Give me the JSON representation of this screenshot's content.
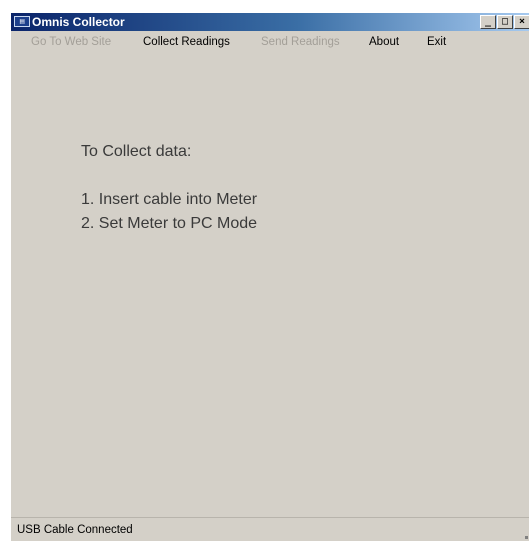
{
  "window": {
    "title": "Omnis Collector",
    "icon": "app-icon",
    "controls": {
      "minimize": "_",
      "maximize": "□",
      "close": "×"
    }
  },
  "menu": {
    "items": [
      {
        "label": "Go To Web Site",
        "enabled": false
      },
      {
        "label": "Collect Readings",
        "enabled": true
      },
      {
        "label": "Send Readings",
        "enabled": false
      },
      {
        "label": "About",
        "enabled": true
      },
      {
        "label": "Exit",
        "enabled": true
      }
    ]
  },
  "instructions": {
    "heading": "To Collect data:",
    "steps": [
      "1. Insert cable into Meter",
      "2. Set Meter to PC Mode"
    ]
  },
  "status": {
    "text": "USB Cable Connected"
  },
  "colors": {
    "titlebar_start": "#0a246a",
    "titlebar_end": "#a6caf0",
    "window_bg": "#d4d0c8",
    "disabled_text": "#a39f98"
  }
}
